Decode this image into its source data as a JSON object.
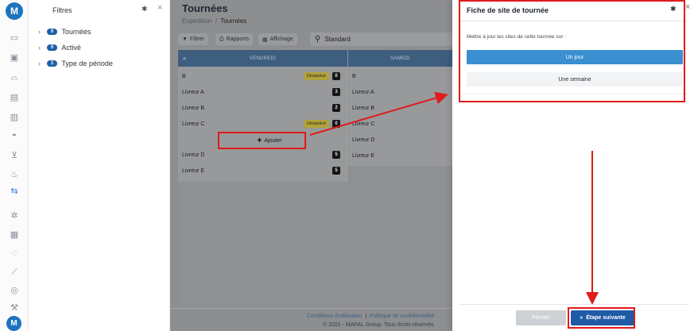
{
  "rail": {
    "logo": "M",
    "icons": [
      "truck-icon",
      "box-icon",
      "chef-hat-icon",
      "receipt-icon",
      "clipboard-icon",
      "dish-icon",
      "cart-icon",
      "cutlery-icon",
      "delivery-icon",
      "cog-icon",
      "calculator-icon",
      "chat-icon",
      "tool-icon",
      "database-icon",
      "wrench-icon"
    ]
  },
  "filters": {
    "title": "Filtres",
    "items": [
      {
        "label": "Tournées",
        "count": "0"
      },
      {
        "label": "Activé",
        "count": "0"
      },
      {
        "label": "Type de période",
        "count": "1"
      }
    ]
  },
  "main": {
    "title": "Tournées",
    "breadcrumb": {
      "parent": "Expédition",
      "sep": "/",
      "current": "Tournées"
    },
    "toolbar": {
      "filter": "Filtrer",
      "reports": "Rapports",
      "display": "Affichage",
      "search_value": "Standard"
    },
    "columns": [
      {
        "label": "VENDREDI"
      },
      {
        "label": "SAMEDI"
      }
    ],
    "friday_rows": [
      {
        "name": "B",
        "tag": "Désactivé",
        "count": "0"
      },
      {
        "name": "Livreur A",
        "tag": "",
        "count": "3"
      },
      {
        "name": "Livreur B",
        "tag": "",
        "count": "2"
      },
      {
        "name": "Livreur C",
        "tag": "Désactivé",
        "count": "0"
      }
    ],
    "friday_rows_after": [
      {
        "name": "Livreur D",
        "count": "5"
      },
      {
        "name": "Livreur E",
        "count": "5"
      }
    ],
    "add_label": "Ajouter",
    "saturday_rows": [
      "B",
      "Livreur A",
      "Livreur B",
      "Livreur C",
      "Livreur D",
      "Livreur E"
    ],
    "footer": {
      "terms": "Conditions d'utilisation",
      "sep": "|",
      "privacy": "Politique de confidentialité",
      "copyright": "© 2021 - MAPAL Group. Tous droits réservés"
    }
  },
  "panel": {
    "title": "Fiche de site de tournée",
    "prompt": "Mettre à jour les sites de cette tournée sur :",
    "option_one_day": "Un jour",
    "option_one_week": "Une semaine",
    "close_label": "Fermer",
    "next_label": "Étape suivante"
  },
  "colors": {
    "accent": "#1f5aa6",
    "highlight": "#e11a1a",
    "option_selected": "#3a8fd0"
  }
}
